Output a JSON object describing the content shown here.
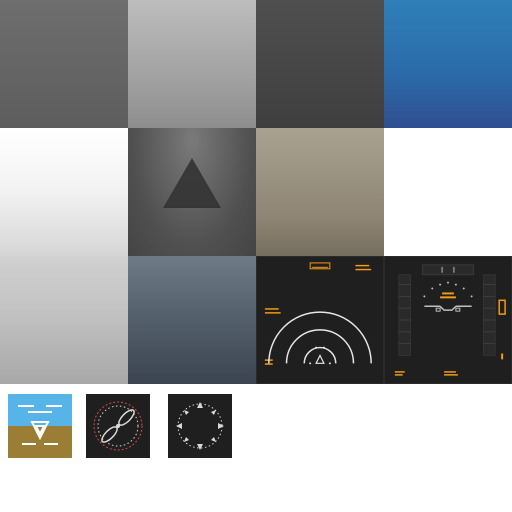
{
  "atlas": {
    "tiles": [
      {
        "id": "tile-01",
        "kind": "texture",
        "color": "#666666"
      },
      {
        "id": "tile-02",
        "kind": "texture",
        "color": "#a9a9a9"
      },
      {
        "id": "tile-03",
        "kind": "texture",
        "color": "#474747"
      },
      {
        "id": "tile-04",
        "kind": "texture",
        "color": "#2d6fb0"
      },
      {
        "id": "tile-05",
        "kind": "texture",
        "color": "#d7d7d7"
      },
      {
        "id": "tile-06",
        "kind": "texture",
        "color": "#5a5a5a",
        "icon": "triangle-icon"
      },
      {
        "id": "tile-07",
        "kind": "texture",
        "color": "#8e8574"
      },
      {
        "id": "tile-08",
        "kind": "texture",
        "color": "#52606c"
      }
    ],
    "panels": [
      {
        "id": "panel-01",
        "name": "radar-arc-panel",
        "accent": "#f39c12",
        "line": "#e6e6e6"
      },
      {
        "id": "panel-02",
        "name": "attitude-scale-panel",
        "accent": "#f39c12",
        "line": "#bfbfbf"
      }
    ],
    "icons": [
      {
        "id": "icon-attitude",
        "name": "attitude-indicator-icon",
        "sky": "#56b4e9",
        "ground": "#9b7d35",
        "mark": "#ffffff"
      },
      {
        "id": "icon-heading",
        "name": "propeller-gauge-icon",
        "ring": "#d84a4a",
        "line": "#d9d9d9"
      },
      {
        "id": "icon-compass",
        "name": "compass-rose-icon",
        "line": "#d9d9d9"
      }
    ]
  }
}
